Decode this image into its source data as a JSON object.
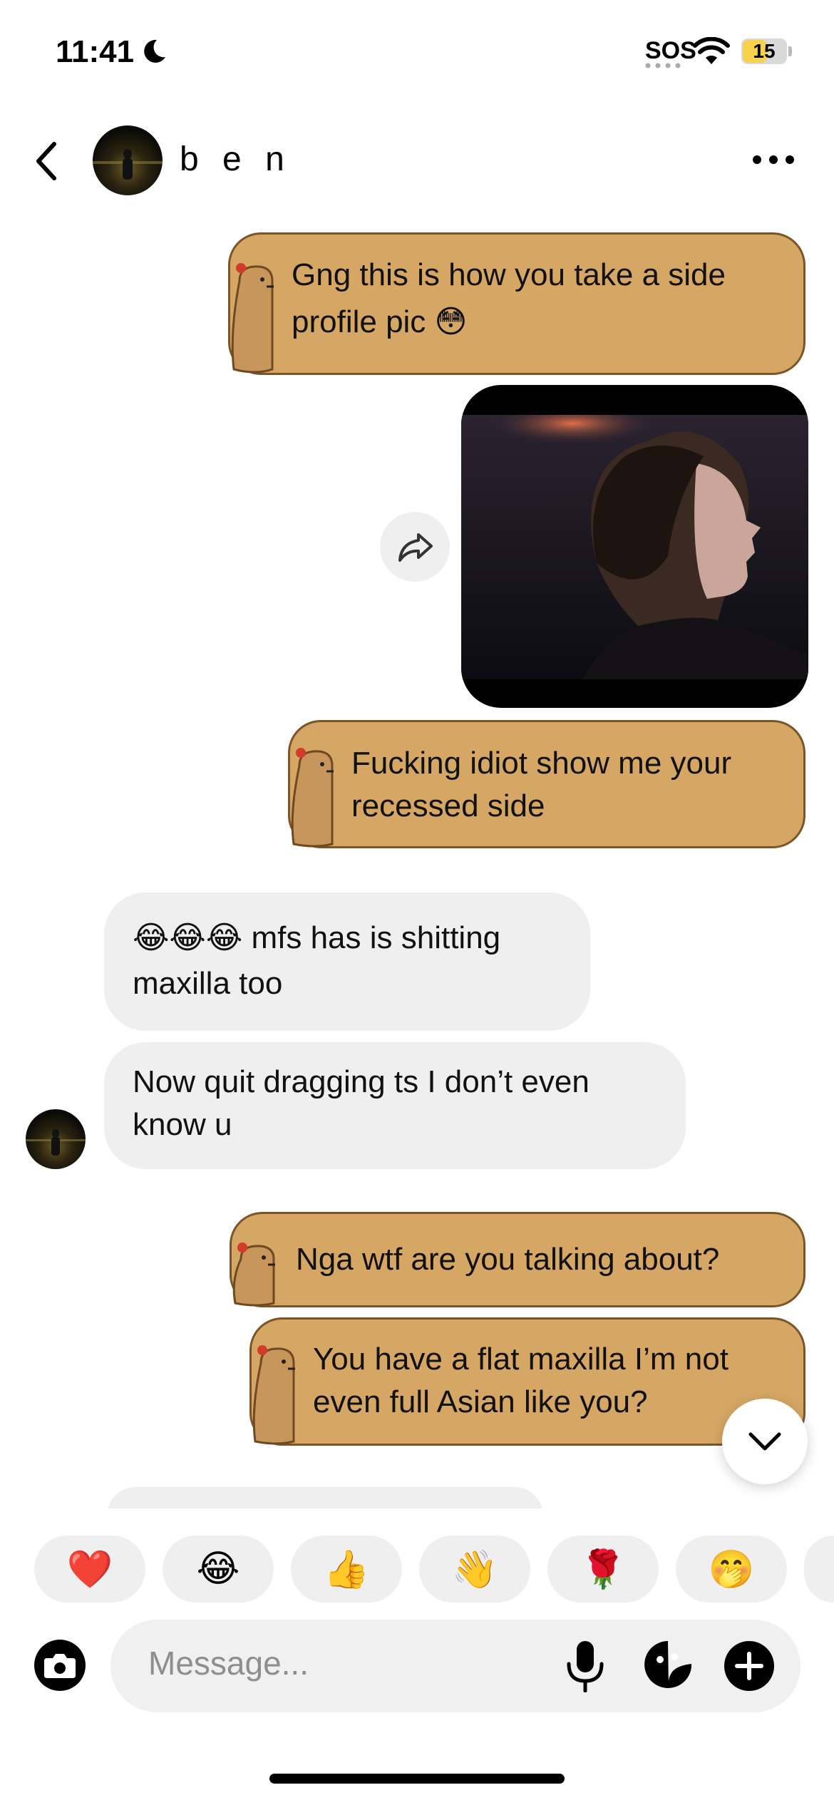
{
  "status_bar": {
    "time": "11:41",
    "sos": "SOS",
    "battery": "15",
    "battery_color": "#f6d34b"
  },
  "header": {
    "contact_name": "b e n",
    "back_icon": "chevron-left-icon",
    "more_icon": "more-horizontal-icon"
  },
  "messages": [
    {
      "sender": "me",
      "type": "text",
      "lines": [
        "Gng this is how you take a side",
        "profile pic 😳"
      ]
    },
    {
      "sender": "me",
      "type": "image"
    },
    {
      "sender": "me",
      "type": "text",
      "lines": [
        "Fucking idiot show me your",
        "recessed side"
      ]
    },
    {
      "sender": "them",
      "type": "text",
      "lines": [
        "😂😂😂 mfs has is shitting",
        "maxilla too"
      ]
    },
    {
      "sender": "them",
      "type": "text",
      "lines": [
        "Now quit dragging ts I don’t even",
        "know u"
      ]
    },
    {
      "sender": "me",
      "type": "text",
      "lines": [
        "Nga wtf are you talking about?"
      ]
    },
    {
      "sender": "me",
      "type": "text",
      "lines": [
        "You have a flat maxilla I’m not",
        "even full Asian like you?"
      ]
    }
  ],
  "reactions": [
    "❤️",
    "😂",
    "👍",
    "👋",
    "🌹",
    "🤭"
  ],
  "composer": {
    "placeholder": "Message..."
  },
  "colors": {
    "bubble_me": "#d6a764",
    "bubble_me_border": "#7a5527",
    "bubble_them": "#efefef"
  }
}
